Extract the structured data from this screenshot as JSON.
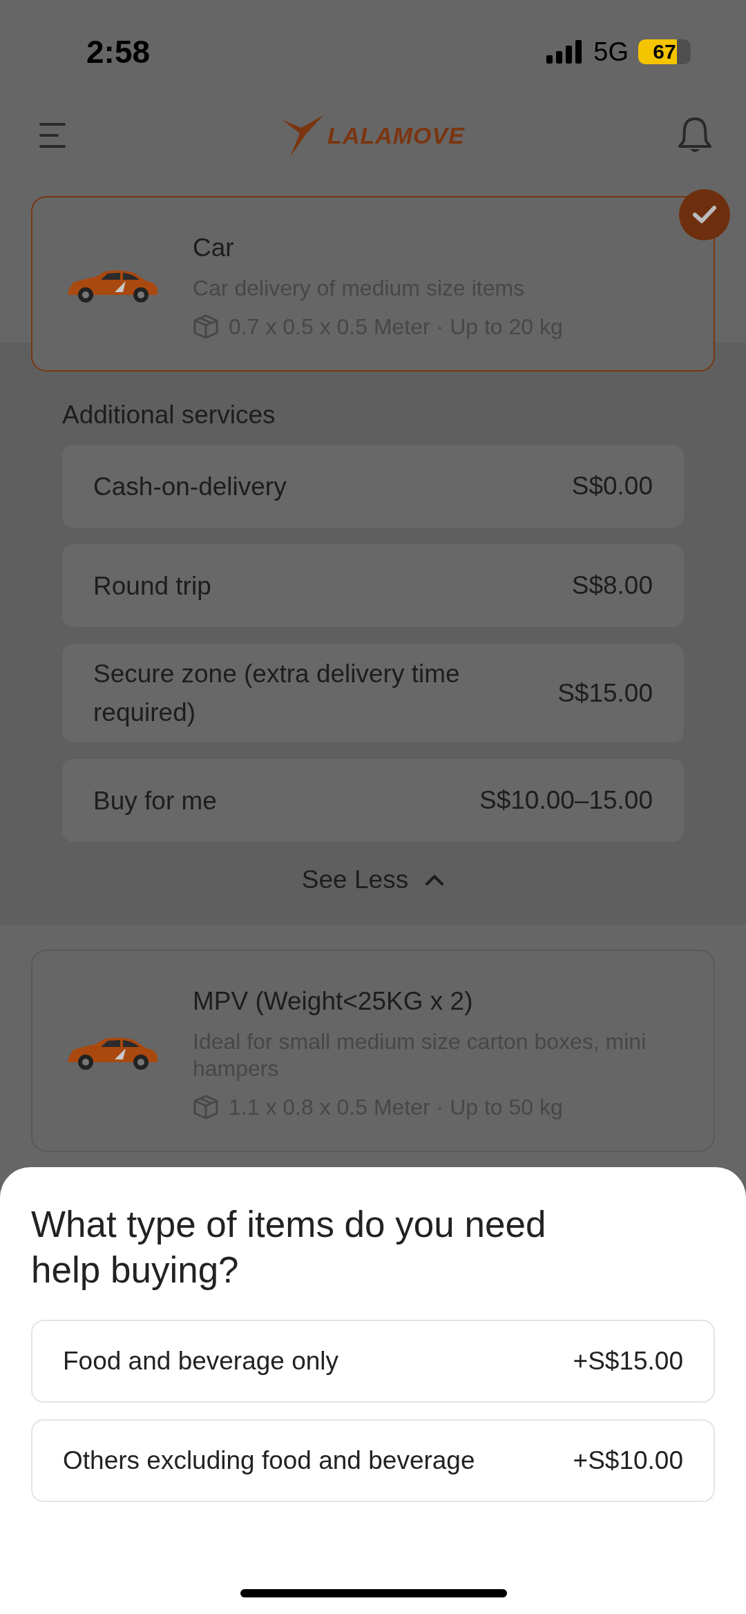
{
  "status_bar": {
    "time": "2:58",
    "network": "5G",
    "battery": "67"
  },
  "header": {
    "logo": "LALAMOVE"
  },
  "vehicles": [
    {
      "name": "Car",
      "description": "Car delivery of medium size items",
      "specs": "0.7 x 0.5 x 0.5 Meter · Up to 20 kg",
      "selected": true
    },
    {
      "name": "MPV (Weight<25KG x 2)",
      "description": "Ideal for small medium size carton boxes, mini hampers",
      "specs": "1.1 x 0.8 x 0.5 Meter · Up to 50 kg",
      "selected": false
    }
  ],
  "additional_services": {
    "title": "Additional services",
    "items": [
      {
        "name": "Cash-on-delivery",
        "price": "S$0.00"
      },
      {
        "name": "Round trip",
        "price": "S$8.00"
      },
      {
        "name": "Secure zone (extra delivery time required)",
        "price": "S$15.00"
      },
      {
        "name": "Buy for me",
        "price": "S$10.00–15.00"
      }
    ],
    "toggle": "See Less"
  },
  "sheet": {
    "title": "What type of items do you need help buying?",
    "options": [
      {
        "label": "Food and beverage only",
        "price": "+S$15.00"
      },
      {
        "label": "Others excluding food and beverage",
        "price": "+S$10.00"
      }
    ]
  }
}
